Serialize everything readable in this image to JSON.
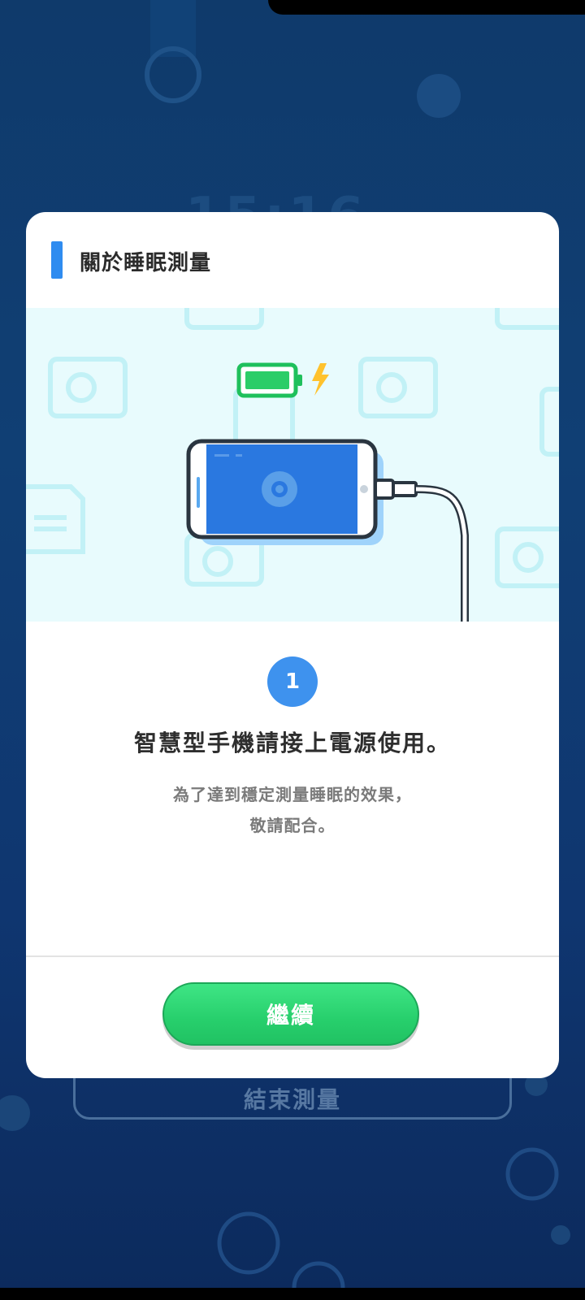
{
  "background": {
    "clock_text": "15:16",
    "end_button_label": "結束測量"
  },
  "dialog": {
    "title": "關於睡眠測量",
    "illustration_icons": [
      "battery-full-icon",
      "lightning-icon",
      "phone-charging-icon"
    ],
    "step": {
      "number": "1",
      "title": "智慧型手機請接上電源使用。",
      "description_line1": "為了達到穩定測量睡眠的效果，",
      "description_line2": "敬請配合。"
    },
    "continue_label": "繼續"
  },
  "colors": {
    "accent_blue": "#2f8cf0",
    "button_green": "#27cf6c",
    "background_navy": "#0f3a6b",
    "illustration_bg": "#e8fbfd"
  }
}
